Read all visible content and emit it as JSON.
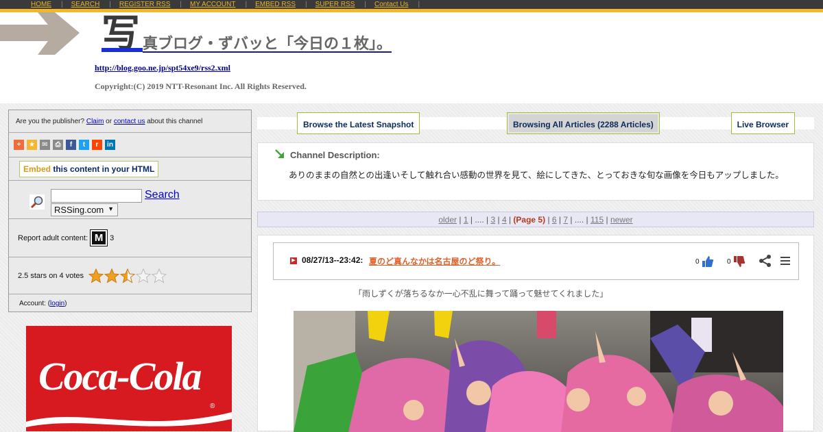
{
  "nav": [
    "HOME",
    "SEARCH",
    "REGISTER RSS",
    "MY ACCOUNT",
    "EMBED RSS",
    "SUPER RSS",
    "Contact Us"
  ],
  "header": {
    "title_first_char": "写",
    "title_rest": "真ブログ・ずバッと「今日の１枚」。",
    "feed_url": "http://blog.goo.ne.jp/spt54xe9/rss2.xml",
    "copyright": "Copyright:(C) 2019 NTT-Resonant Inc. All Rights Reserved."
  },
  "sidebar": {
    "publisher_prefix": "Are you the publisher? ",
    "claim": "Claim",
    "or": " or ",
    "contact_us": "contact us",
    "publisher_suffix": " about this channel",
    "share_icons": [
      "plus",
      "star",
      "email",
      "print",
      "facebook",
      "twitter",
      "reddit",
      "linkedin"
    ],
    "share_colors": [
      "#f26b3a",
      "#f5b731",
      "#8a8a8a",
      "#8a8a8a",
      "#3b5998",
      "#1da1f2",
      "#ff4500",
      "#0077b5"
    ],
    "embed_highlight": "Embed",
    "embed_rest": " this content in your HTML",
    "search_link": "Search",
    "search_select": "RSSing.com",
    "adult_label": "Report adult content:",
    "mature_badge": "M",
    "adult_count": "3",
    "stars_label": "2.5 stars on 4 votes",
    "stars_rating": 2.5,
    "account_label": "Account: (",
    "login": "login",
    "account_close": ")"
  },
  "ad": {
    "brand": "Coca-Cola",
    "registered": "®"
  },
  "browse": {
    "latest": "Browse the Latest Snapshot",
    "all": "Browsing All Articles (2288 Articles)",
    "live": "Live Browser"
  },
  "description": {
    "title": "Channel Description:",
    "text": "ありのままの自然との出逢いそして触れ合い感動の世界を見て、絵にしてきた、とっておきな旬な画像を今日もアップしました。"
  },
  "pager": {
    "older": "older",
    "p1": "1",
    "dots1": "....",
    "p3": "3",
    "p4": "4",
    "current": "(Page 5)",
    "p6": "6",
    "p7": "7",
    "dots2": "....",
    "p115": "115",
    "newer": "newer"
  },
  "article": {
    "date": "08/27/13--23:42:",
    "title": "夏のど真んなかは名古屋のど祭り。",
    "up_count": "0",
    "down_count": "0",
    "excerpt": "「雨しずくが落ちるなか一心不乱に舞って踊って魅せてくれました」"
  }
}
